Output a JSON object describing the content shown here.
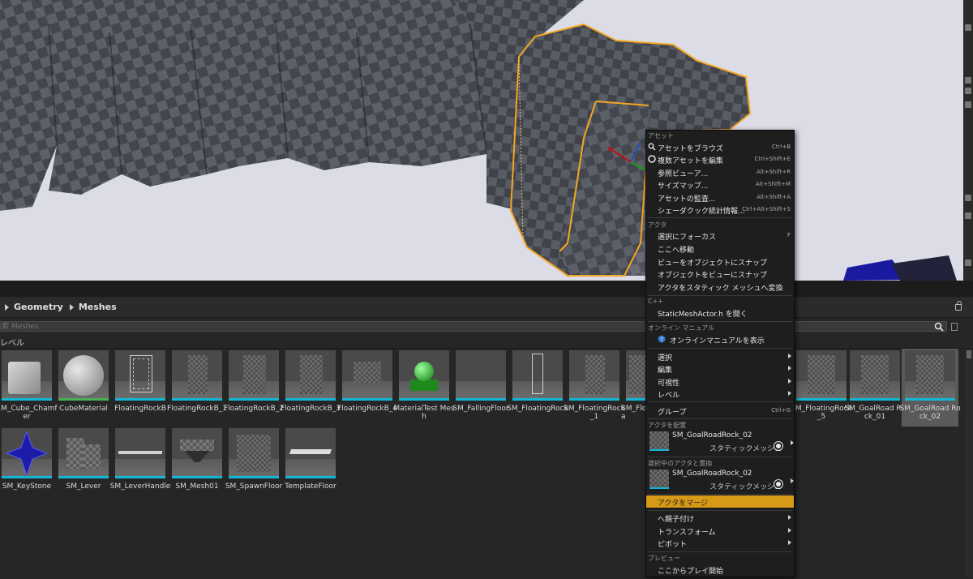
{
  "breadcrumb": {
    "items": [
      "Geometry",
      "Meshes"
    ]
  },
  "search": {
    "placeholder": "索 Meshes"
  },
  "filter": {
    "label": "レベル"
  },
  "assets": [
    {
      "label": "1M_Cube_Chamfer"
    },
    {
      "label": "CubeMaterial"
    },
    {
      "label": "FloatingRockB"
    },
    {
      "label": "FloatingRockB_1"
    },
    {
      "label": "FloatingRockB_2"
    },
    {
      "label": "FloatingRockB_3"
    },
    {
      "label": "FloatingRockB_4"
    },
    {
      "label": "MaterialTest Mesh"
    },
    {
      "label": "SM_FallingFloor"
    },
    {
      "label": "SM_FloatingRock"
    },
    {
      "label": "SM_FloatingRock _1"
    },
    {
      "label": "SM_Floa"
    },
    {
      "label": "SM_FloatingRock _5"
    },
    {
      "label": "SM_GoalRoad Rock_01"
    },
    {
      "label": "SM_GoalRoad Rock_02"
    },
    {
      "label": "SM_KeyStone"
    },
    {
      "label": "SM_Lever"
    },
    {
      "label": "SM_LeverHandle"
    },
    {
      "label": "SM_Mesh01"
    },
    {
      "label": "SM_SpawnFloor"
    },
    {
      "label": "TemplateFloor"
    }
  ],
  "context_menu": {
    "sections": {
      "asset": "アセット",
      "actor": "アクタ",
      "cpp": "C++",
      "online_manual": "オンライン マニュアル",
      "place_actor": "アクタを配置",
      "replace_selected": "選択中のアクタと置換",
      "preview": "プレビュー"
    },
    "items": {
      "browse_asset": {
        "label": "アセットをブラウズ",
        "shortcut": "Ctrl+B"
      },
      "edit_multiple": {
        "label": "複数アセットを編集",
        "shortcut": "Ctrl+Shift+E"
      },
      "reference_viewer": {
        "label": "参照ビューア...",
        "shortcut": "Alt+Shift+R"
      },
      "size_map": {
        "label": "サイズマップ...",
        "shortcut": "Alt+Shift+M"
      },
      "audit_assets": {
        "label": "アセットの監査...",
        "shortcut": "Alt+Shift+A"
      },
      "shader_cook_stats": {
        "label": "シェーダクック統計情報...",
        "shortcut": "Ctrl+Alt+Shift+S"
      },
      "focus_selected": {
        "label": "選択にフォーカス",
        "shortcut": "F"
      },
      "move_here": {
        "label": "ここへ移動"
      },
      "snap_view_to_object": {
        "label": "ビューをオブジェクトにスナップ"
      },
      "snap_object_to_view": {
        "label": "オブジェクトをビューにスナップ"
      },
      "convert_to_static_mesh": {
        "label": "アクタをスタティック メッシュへ変換"
      },
      "open_header": {
        "label": "StaticMeshActor.h を開く"
      },
      "show_online_manual": {
        "label": "オンラインマニュアルを表示"
      },
      "select": {
        "label": "選択"
      },
      "edit": {
        "label": "編集"
      },
      "visibility": {
        "label": "可視性"
      },
      "level": {
        "label": "レベル"
      },
      "group": {
        "label": "グループ",
        "shortcut": "Ctrl+G"
      },
      "merge_actors": {
        "label": "アクタをマージ"
      },
      "attach_to": {
        "label": "へ親子付け"
      },
      "transform": {
        "label": "トランスフォーム"
      },
      "pivot": {
        "label": "ピボット"
      },
      "play_from_here": {
        "label": "ここからプレイ開始"
      }
    },
    "place_asset": {
      "name": "SM_GoalRoadRock_02",
      "type": "スタティックメッシュ"
    },
    "replace_asset": {
      "name": "SM_GoalRoadRock_02",
      "type": "スタティックメッシュ"
    }
  },
  "colors": {
    "selection_outline": "#f5a623",
    "menu_highlight": "#d79a16",
    "static_mesh_bar": "#12b7d6"
  }
}
